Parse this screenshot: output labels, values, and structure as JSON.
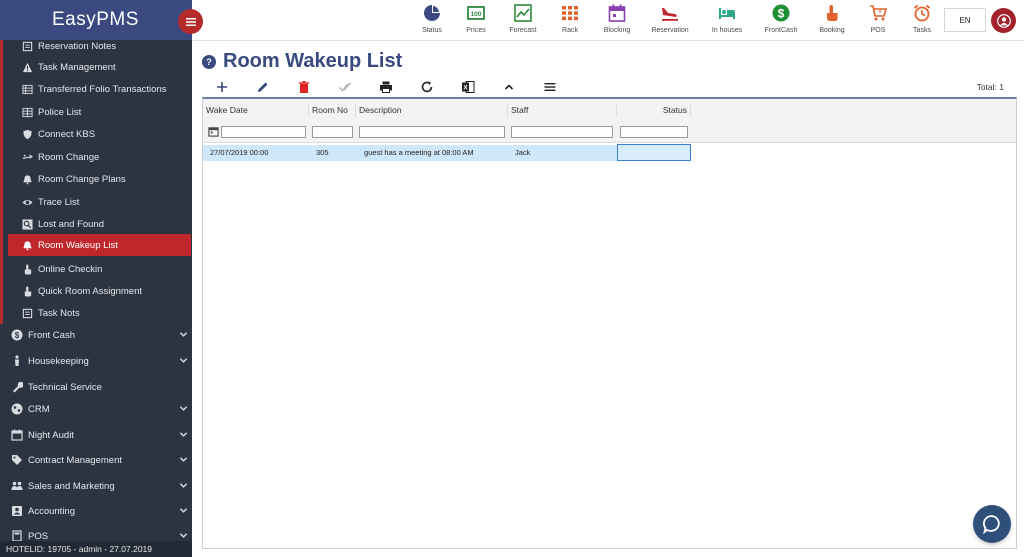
{
  "app": {
    "brand": "EasyPMS"
  },
  "colors": {
    "accent": "#3a4a80",
    "danger": "#c0272d",
    "sidebar": "#2c3442"
  },
  "topnav": [
    {
      "label": "Status",
      "icon": "pie-chart-icon",
      "color": "#3a4a80"
    },
    {
      "label": "Prices",
      "icon": "money-icon",
      "color": "#2e8b3e"
    },
    {
      "label": "Forecast",
      "icon": "line-chart-icon",
      "color": "#2e8b3e"
    },
    {
      "label": "Rack",
      "icon": "grid-icon",
      "color": "#e2622d"
    },
    {
      "label": "Blocking",
      "icon": "calendar-icon",
      "color": "#8a3fb0"
    },
    {
      "label": "Reservation",
      "icon": "plane-landing-icon",
      "color": "#c0272d"
    },
    {
      "label": "In houses",
      "icon": "bed-icon",
      "color": "#2eaa8a"
    },
    {
      "label": "FrontCash",
      "icon": "dollar-circle-icon",
      "color": "#1f8f35"
    },
    {
      "label": "Booking",
      "icon": "hand-pointer-icon",
      "color": "#e2622d"
    },
    {
      "label": "POS",
      "icon": "cart-icon",
      "color": "#e2622d"
    },
    {
      "label": "Tasks",
      "icon": "alarm-clock-icon",
      "color": "#e2622d"
    }
  ],
  "lang": "EN",
  "sidebar": {
    "sub_items": [
      {
        "label": "Reservation Notes",
        "icon": "note-icon"
      },
      {
        "label": "Task Management",
        "icon": "warning-icon"
      },
      {
        "label": "Transferred Folio Transactions",
        "icon": "list-icon"
      },
      {
        "label": "Police List",
        "icon": "table-icon"
      },
      {
        "label": "Connect KBS",
        "icon": "shield-icon"
      },
      {
        "label": "Room Change",
        "icon": "exchange-icon"
      },
      {
        "label": "Room Change Plans",
        "icon": "bell-icon"
      },
      {
        "label": "Trace List",
        "icon": "eye-icon"
      },
      {
        "label": "Lost and Found",
        "icon": "search-icon"
      },
      {
        "label": "Room Wakeup List",
        "icon": "bell-icon",
        "active": true
      },
      {
        "label": "Online Checkin",
        "icon": "hand-pointer-icon"
      },
      {
        "label": "Quick Room Assignment",
        "icon": "hand-pointer-icon"
      },
      {
        "label": "Task Nots",
        "icon": "note-icon"
      }
    ],
    "groups": [
      {
        "label": "Front Cash",
        "icon": "dollar-circle-icon",
        "chevron": true
      },
      {
        "label": "Housekeeping",
        "icon": "person-icon",
        "chevron": true
      },
      {
        "label": "Technical Service",
        "icon": "wrench-icon",
        "chevron": false
      },
      {
        "label": "CRM",
        "icon": "globe-icon",
        "chevron": true
      },
      {
        "label": "Night Audit",
        "icon": "calendar-icon",
        "chevron": true
      },
      {
        "label": "Contract Management",
        "icon": "tag-icon",
        "chevron": true
      },
      {
        "label": "Sales and Marketing",
        "icon": "people-icon",
        "chevron": true
      },
      {
        "label": "Accounting",
        "icon": "contact-icon",
        "chevron": true
      },
      {
        "label": "POS",
        "icon": "pos-icon",
        "chevron": true
      }
    ],
    "footer": "HOTELID: 19705 - admin - 27.07.2019"
  },
  "page": {
    "title": "Room Wakeup List",
    "total": "Total: 1"
  },
  "toolbar": [
    "add-icon",
    "edit-icon",
    "delete-icon",
    "check-icon",
    "print-icon",
    "refresh-icon",
    "excel-icon",
    "chevron-up-icon",
    "menu-icon"
  ],
  "grid": {
    "columns": [
      "Wake Date",
      "Room No",
      "Description",
      "Staff",
      "Status"
    ],
    "rows": [
      {
        "wake_date": "27/07/2019 00:00",
        "room_no": "305",
        "description": "guest has a meeting at 08:00 AM",
        "staff": "Jack",
        "status": ""
      }
    ]
  }
}
